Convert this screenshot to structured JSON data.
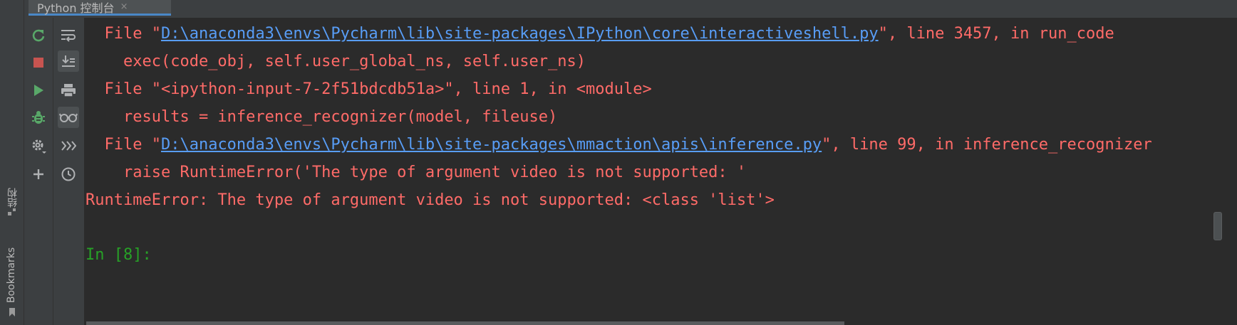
{
  "tab": {
    "title": "Python 控制台",
    "close": "×"
  },
  "left_strip": {
    "structure_label": "结构",
    "bookmarks_label": "Bookmarks"
  },
  "toolbar": {
    "rerun": "rerun-icon",
    "stop": "stop-icon",
    "run": "run-icon",
    "debug": "debug-icon",
    "settings": "gear-icon",
    "add": "plus-icon",
    "soft_wrap": "soft-wrap-icon",
    "scroll_to_end": "scroll-to-end-icon",
    "print": "print-icon",
    "show_variables": "glasses-icon",
    "execute_command": "execute-icon",
    "history": "history-icon"
  },
  "colors": {
    "error": "#ff6b68",
    "link": "#589df6",
    "prompt": "#27a127",
    "background": "#2b2b2b"
  },
  "console": {
    "line1": {
      "prefix": "  File \"",
      "link": "D:\\anaconda3\\envs\\Pycharm\\lib\\site-packages\\IPython\\core\\interactiveshell.py",
      "suffix": "\", line 3457, in run_code"
    },
    "line2": "    exec(code_obj, self.user_global_ns, self.user_ns)",
    "line3": "  File \"<ipython-input-7-2f51bdcdb51a>\", line 1, in <module>",
    "line4": "    results = inference_recognizer(model, fileuse)",
    "line5": {
      "prefix": "  File \"",
      "link": "D:\\anaconda3\\envs\\Pycharm\\lib\\site-packages\\mmaction\\apis\\inference.py",
      "suffix": "\", line 99, in inference_recognizer"
    },
    "line6": "    raise RuntimeError('The type of argument video is not supported: '",
    "line7": "RuntimeError: The type of argument video is not supported: <class 'list'>",
    "prompt": "In [8]:"
  }
}
